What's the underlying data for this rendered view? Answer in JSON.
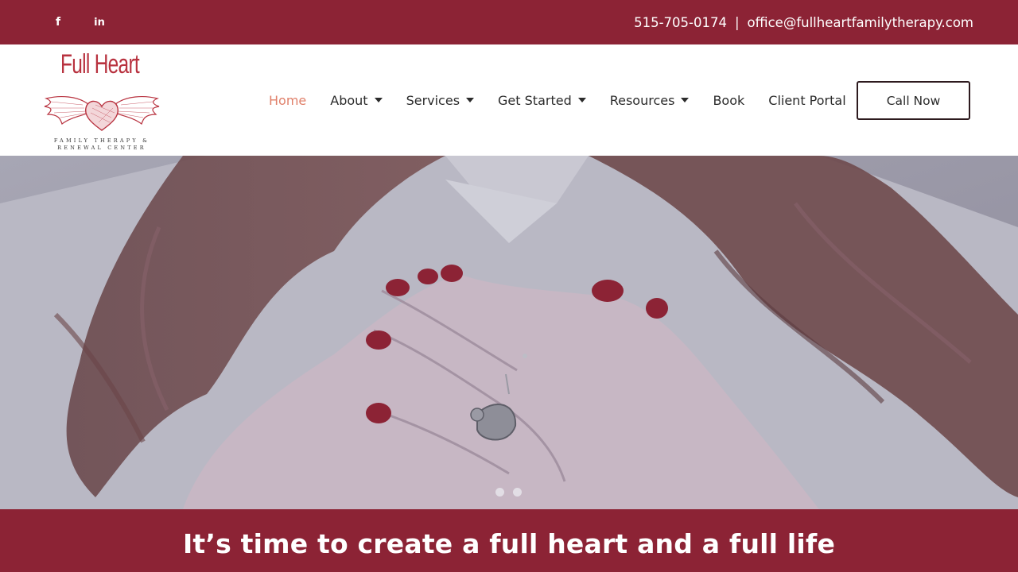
{
  "topbar": {
    "social": [
      {
        "icon": "facebook-icon",
        "glyph": "f"
      },
      {
        "icon": "linkedin-icon",
        "glyph": "in"
      }
    ],
    "phone": "515-705-0174",
    "separator": "|",
    "email": "office@fullheartfamilytherapy.com"
  },
  "logo": {
    "title": "Full Heart",
    "tagline_line1": "FAMILY THERAPY &",
    "tagline_line2": "RENEWAL CENTER"
  },
  "nav": {
    "items": [
      {
        "label": "Home",
        "active": true
      },
      {
        "label": "About",
        "dropdown": true
      },
      {
        "label": "Services",
        "dropdown": true
      },
      {
        "label": "Get Started",
        "dropdown": true
      },
      {
        "label": "Resources",
        "dropdown": true
      },
      {
        "label": "Book"
      },
      {
        "label": "Client Portal"
      }
    ],
    "cta_label": "Call Now"
  },
  "hero": {
    "slide_count": 2
  },
  "banner": {
    "headline": "It’s time to create a full heart and a full life"
  },
  "colors": {
    "brand": "#8c2335",
    "active_nav": "#e0806a",
    "logo": "#b8323f"
  }
}
